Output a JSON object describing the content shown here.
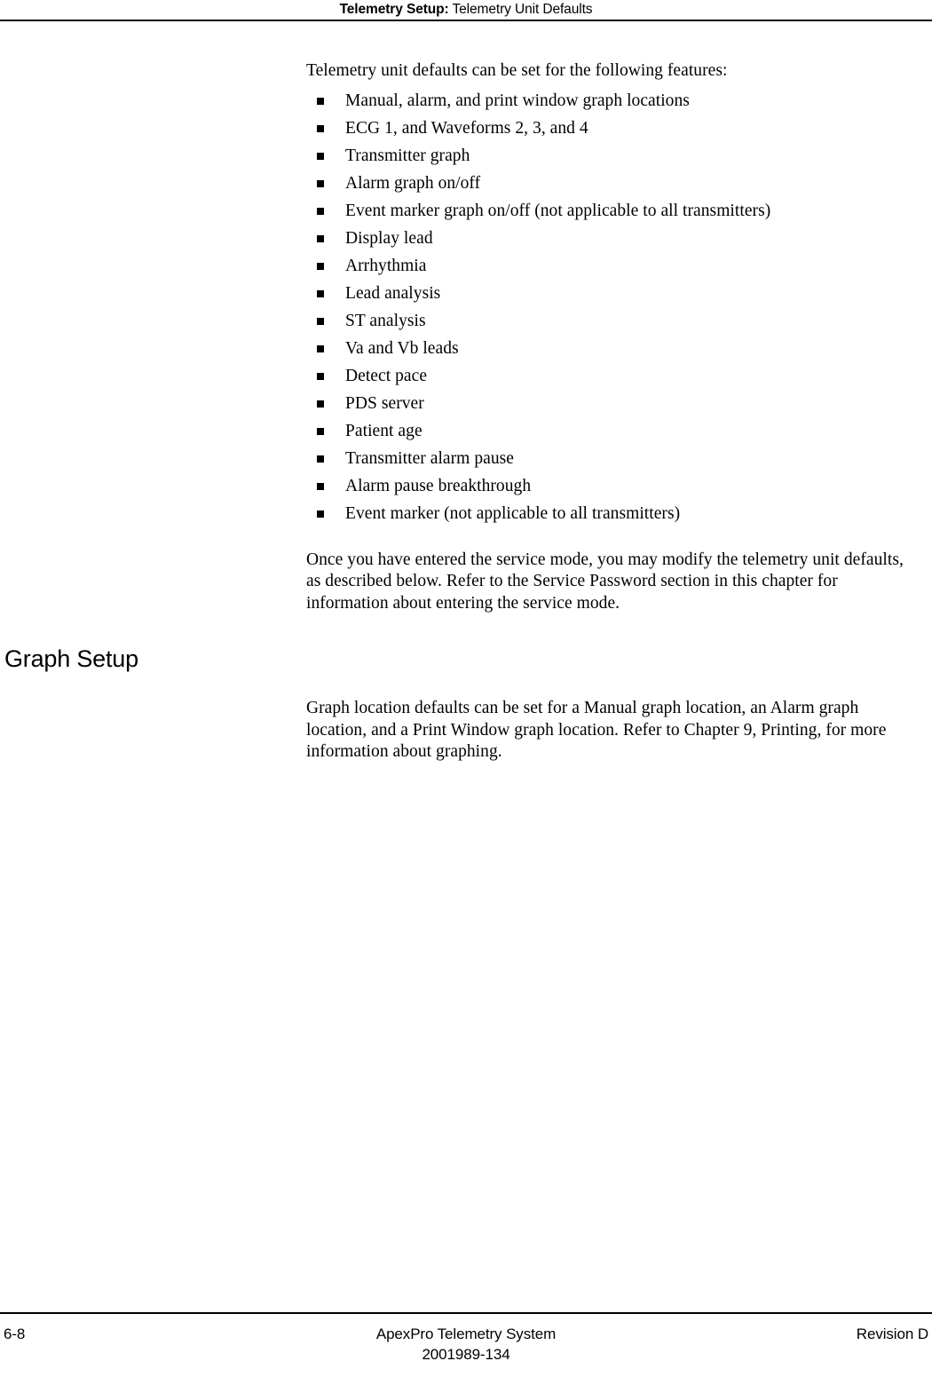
{
  "header": {
    "chapter_label": "Telemetry Setup:",
    "section_label": " Telemetry Unit Defaults"
  },
  "body": {
    "intro_paragraph": "Telemetry unit defaults can be set for the following features:",
    "feature_bullets": [
      "Manual, alarm, and print window graph locations",
      "ECG 1, and Waveforms 2, 3, and 4",
      "Transmitter graph",
      "Alarm graph on/off",
      "Event marker graph on/off (not applicable to all transmitters)",
      "Display lead",
      "Arrhythmia",
      "Lead analysis",
      "ST analysis",
      "Va and Vb leads",
      "Detect pace",
      "PDS server",
      "Patient age",
      "Transmitter alarm pause",
      "Alarm pause breakthrough",
      "Event marker (not applicable to all transmitters)"
    ],
    "service_mode_paragraph": "Once you have entered the service mode, you may modify the telemetry unit defaults, as described below. Refer to the Service Password section in this chapter for information about entering the service mode."
  },
  "graph_setup": {
    "heading": "Graph Setup",
    "paragraph": "Graph location defaults can be set for a Manual graph location, an Alarm graph location, and a Print Window graph location. Refer to Chapter 9, Printing, for more information about graphing."
  },
  "footer": {
    "page_number": "6-8",
    "product_name": "ApexPro Telemetry System",
    "document_number": "2001989-134",
    "revision": "Revision D"
  },
  "colors": {
    "text": "#000000",
    "rule": "#000000",
    "background": "#ffffff"
  }
}
